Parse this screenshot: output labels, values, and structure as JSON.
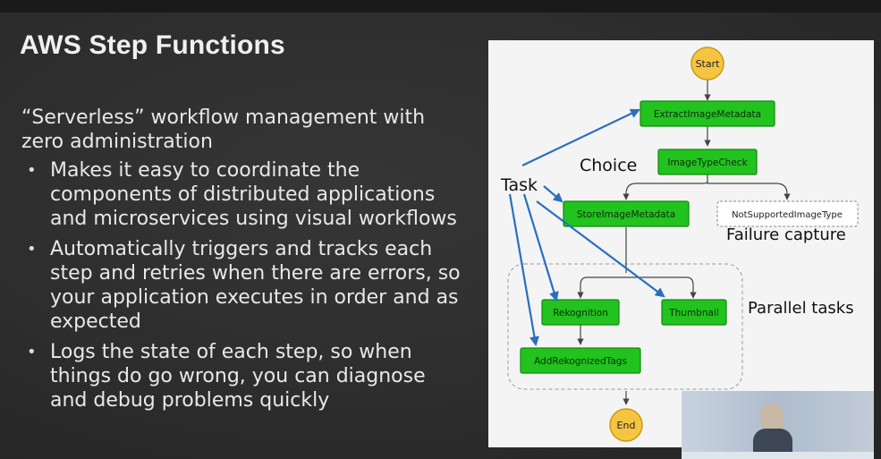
{
  "slide": {
    "title": "AWS Step Functions",
    "intro": "“Serverless” workflow management with zero administration",
    "bullets": [
      "Makes it easy to coordinate the components of distributed applications and microservices using visual workflows",
      "Automatically triggers and tracks each step and retries when there are errors, so your application executes in order and as expected",
      "Logs the state of each step, so when things do go wrong, you can diagnose and debug problems quickly"
    ],
    "bullet_glyph": "•"
  },
  "diagram": {
    "nodes": {
      "start": "Start",
      "extract": "ExtractImageMetadata",
      "check": "ImageTypeCheck",
      "store": "StoreImageMetadata",
      "notsupported": "NotSupportedImageType",
      "rekognition": "Rekognition",
      "thumbnail": "Thumbnail",
      "addtags": "AddRekognizedTags",
      "end": "End"
    },
    "annotations": {
      "task": "Task",
      "choice": "Choice",
      "failure": "Failure capture",
      "parallel": "Parallel tasks"
    },
    "colors": {
      "task_fill": "#22c21f",
      "task_border": "#0e8a0c",
      "terminal_fill": "#f5c542",
      "terminal_border": "#c79a12",
      "arrow_blue": "#2a6fbf",
      "edge": "#444444"
    }
  }
}
